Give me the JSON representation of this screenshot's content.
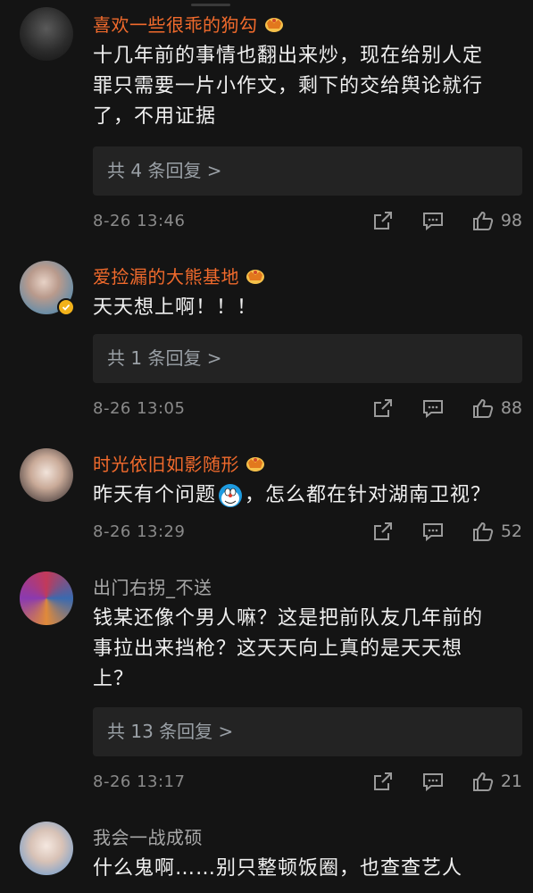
{
  "comments": [
    {
      "username": "喜欢一些很乖的狗勾",
      "lines": [
        "十几年前的事情也翻出来炒，现在给别人定",
        "罪只需要一片小作文，剩下的交给舆论就行",
        "了，不用证据"
      ],
      "replies": "共 4 条回复 >",
      "time": "8-26 13:46",
      "likes": "98"
    },
    {
      "username": "爱捡漏的大熊基地",
      "lines": [
        "天天想上啊！！！"
      ],
      "replies": "共 1 条回复 >",
      "time": "8-26 13:05",
      "likes": "88"
    },
    {
      "username": "时光依旧如影随形",
      "line_before": "昨天有个问题",
      "line_after": "，怎么都在针对湖南卫视？",
      "time": "8-26 13:29",
      "likes": "52"
    },
    {
      "username": "出门右拐_不送",
      "lines": [
        "钱某还像个男人嘛？这是把前队友几年前的",
        "事拉出来挡枪？这天天向上真的是天天想",
        "上？"
      ],
      "replies": "共 13 条回复 >",
      "time": "8-26 13:17",
      "likes": "21"
    },
    {
      "username": "我会一战成硕",
      "lines": [
        "什么鬼啊……别只整顿饭圈，也查查艺人"
      ]
    }
  ],
  "colors": {
    "background": "#141414",
    "vip_name": "#f06a2c",
    "plain_name": "#a8a8a8",
    "replies_bg": "#232323",
    "meta": "#8a8a8a"
  },
  "icons": [
    "crown-icon",
    "verified-icon",
    "share-icon",
    "comment-icon",
    "like-icon",
    "doraemon-emoji-icon"
  ]
}
